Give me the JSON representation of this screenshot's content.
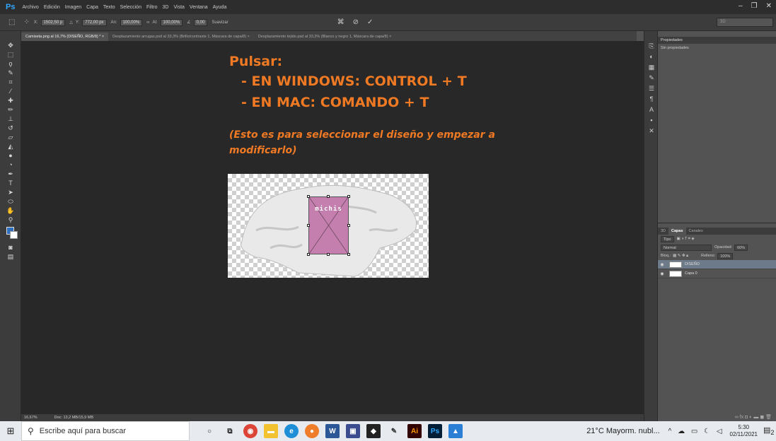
{
  "app": {
    "logo": "Ps"
  },
  "menu": [
    "Archivo",
    "Edición",
    "Imagen",
    "Capa",
    "Texto",
    "Selección",
    "Filtro",
    "3D",
    "Vista",
    "Ventana",
    "Ayuda"
  ],
  "options": {
    "x_label": "X:",
    "x_value": "1502,50 p",
    "y_label": "Y:",
    "y_value": "772,00 px",
    "w_label": "An:",
    "w_value": "100,00%",
    "h_label": "Al:",
    "h_value": "100,00%",
    "angle_value": "0,00",
    "smooth_label": "Suavizar",
    "right_field": "3D"
  },
  "tabs": [
    "Camiseta.png al 16,7% (DISEÑO, RGB/8) * ×",
    "Desplazamiento arrugas.psd al 33,3% (Brillo/contraste 1, Máscara de capa/8) ×",
    "Desplazamiento tejido.psd al 33,3% (Blanco y negro 1, Máscara de capa/8) ×"
  ],
  "canvas": {
    "title": "Pulsar:",
    "line1": "- EN WINDOWS: CONTROL + T",
    "line2": "- EN MAC: COMANDO + T",
    "note": "(Esto es para seleccionar el diseño y empezar a modificarlo)",
    "design_text": "michis",
    "text_color": "#f07a24",
    "design_color": "#c57fae"
  },
  "status": {
    "zoom": "16,67%",
    "doc": "Doc: 13,2 MB/15,9 MB"
  },
  "properties": {
    "title": "Propiedades",
    "subtitle": "Sin propiedades"
  },
  "layers_panel": {
    "tabs": [
      "3D",
      "Capas",
      "Canales"
    ],
    "filter": "Tipo",
    "blend_mode": "Normal",
    "opacity_label": "Opacidad:",
    "opacity_value": "60%",
    "lock_label": "Bloq.:",
    "fill_label": "Relleno:",
    "fill_value": "100%",
    "layers": [
      {
        "name": "DISEÑO",
        "selected": true
      },
      {
        "name": "Capa 0",
        "selected": false
      }
    ]
  },
  "taskbar": {
    "search_placeholder": "Escribe aquí para buscar",
    "weather": "21°C  Mayorm. nubl...",
    "time": "5:30",
    "date": "02/11/2021",
    "notification_count": "2"
  }
}
